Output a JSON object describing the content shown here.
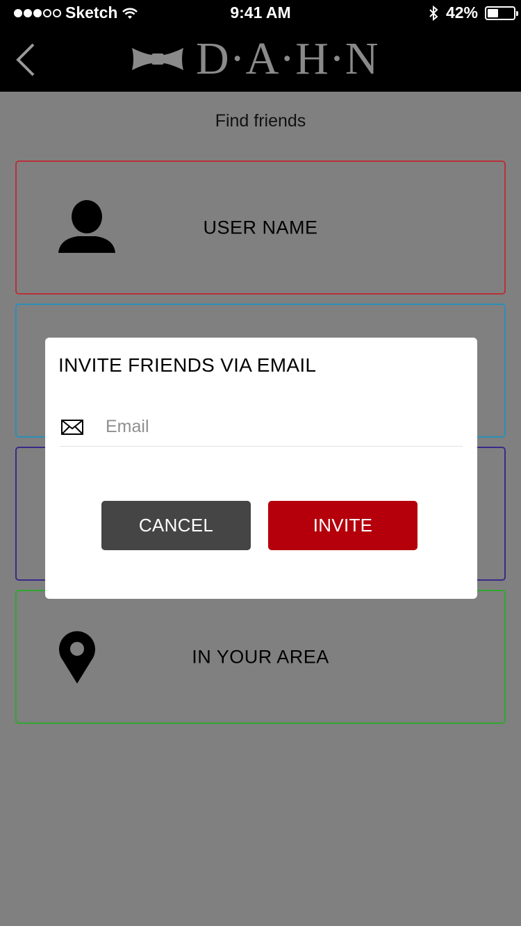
{
  "status_bar": {
    "carrier": "Sketch",
    "time": "9:41 AM",
    "battery_percent": "42%",
    "battery_level": 0.42,
    "signal_bars_filled": 3,
    "signal_bars_total": 5
  },
  "nav": {
    "logo_text": "D·A·H·N"
  },
  "screen": {
    "title": "Find friends"
  },
  "options": [
    {
      "label": "USER NAME",
      "icon": "person-icon",
      "border_color": "#b8323a"
    },
    {
      "label": "",
      "icon": "",
      "border_color": "#2a8fb8"
    },
    {
      "label": "",
      "icon": "",
      "border_color": "#3a2a8a"
    },
    {
      "label": "IN YOUR AREA",
      "icon": "location-pin-icon",
      "border_color": "#2ea82e"
    }
  ],
  "modal": {
    "title": "INVITE FRIENDS VIA EMAIL",
    "email_placeholder": "Email",
    "email_value": "",
    "cancel_label": "CANCEL",
    "invite_label": "INVITE"
  },
  "colors": {
    "overlay_background": "#808080",
    "invite_button": "#b5000c",
    "cancel_button": "#454545"
  }
}
